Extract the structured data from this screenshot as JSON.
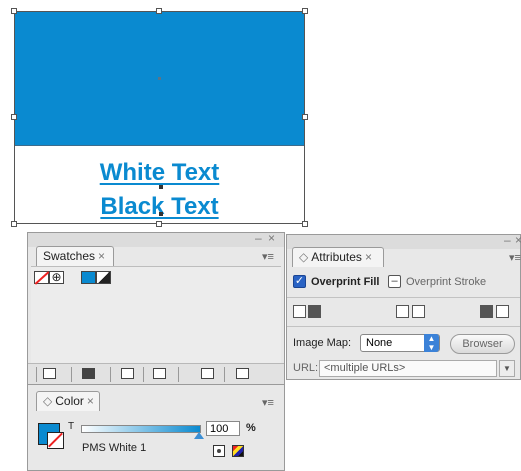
{
  "artboard": {
    "line1": "White Text",
    "line2": "Black Text",
    "fill_color": "#0a8ad0"
  },
  "window_controls": {
    "collapse": "–",
    "close": "×",
    "panel_menu": "▾≡"
  },
  "swatches_panel": {
    "tab_label": "Swatches",
    "swatch_icons": [
      "none-swatch-icon",
      "registration-swatch-icon",
      "fill-stroke-swatch-icon"
    ],
    "toolbar_icons": [
      "show-all-swatches-icon",
      "show-color-swatches-icon",
      "swatch-views-icon",
      "new-color-group-icon",
      "new-swatch-icon",
      "delete-swatch-icon"
    ]
  },
  "color_panel": {
    "tab_label": "Color",
    "tint_label": "T",
    "tint_value": "100",
    "tint_percent": 100,
    "percent_sign": "%",
    "swatch_name": "PMS White 1",
    "fill_color": "#0a8ad0"
  },
  "attributes_panel": {
    "tab_label": "Attributes",
    "overprint_fill_label": "Overprint Fill",
    "overprint_fill_checked": true,
    "overprint_stroke_label": "Overprint Stroke",
    "image_map_label": "Image Map:",
    "image_map_value": "None",
    "browser_label": "Browser",
    "url_label": "URL:",
    "url_value": "<multiple URLs>"
  }
}
